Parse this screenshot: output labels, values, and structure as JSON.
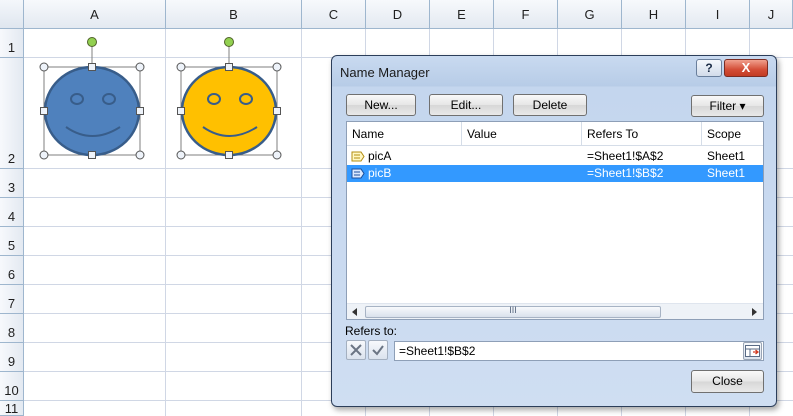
{
  "sheet": {
    "columns": [
      {
        "label": "A"
      },
      {
        "label": "B"
      },
      {
        "label": "C"
      },
      {
        "label": "D"
      },
      {
        "label": "E"
      },
      {
        "label": "F"
      },
      {
        "label": "G"
      },
      {
        "label": "H"
      },
      {
        "label": "I"
      },
      {
        "label": "J"
      }
    ],
    "rows": [
      {
        "label": "1"
      },
      {
        "label": "2"
      },
      {
        "label": "3"
      },
      {
        "label": "4"
      },
      {
        "label": "5"
      },
      {
        "label": "6"
      },
      {
        "label": "7"
      },
      {
        "label": "8"
      },
      {
        "label": "9"
      },
      {
        "label": "10"
      },
      {
        "label": "11"
      }
    ],
    "shapes": [
      {
        "name": "smiley-blue",
        "fill": "#4f81bd",
        "stroke": "#385d8a"
      },
      {
        "name": "smiley-yellow",
        "fill": "#ffc000",
        "stroke": "#385d8a"
      }
    ]
  },
  "dialog": {
    "title": "Name Manager",
    "help_label": "?",
    "close_x_label": "X",
    "buttons": {
      "new_label": "New...",
      "edit_label": "Edit...",
      "delete_label": "Delete",
      "filter_label": "Filter ▾",
      "close_label": "Close"
    },
    "list": {
      "headers": {
        "name": "Name",
        "value": "Value",
        "refers_to": "Refers To",
        "scope": "Scope"
      },
      "rows": [
        {
          "name": "picA",
          "value": "",
          "refers_to": "=Sheet1!$A$2",
          "scope": "Sheet1",
          "selected": false
        },
        {
          "name": "picB",
          "value": "",
          "refers_to": "=Sheet1!$B$2",
          "scope": "Sheet1",
          "selected": true
        }
      ],
      "scroll_grip": "III"
    },
    "refers_label": "Refers to:",
    "refers_value": "=Sheet1!$B$2",
    "accent": "#3399ff"
  }
}
